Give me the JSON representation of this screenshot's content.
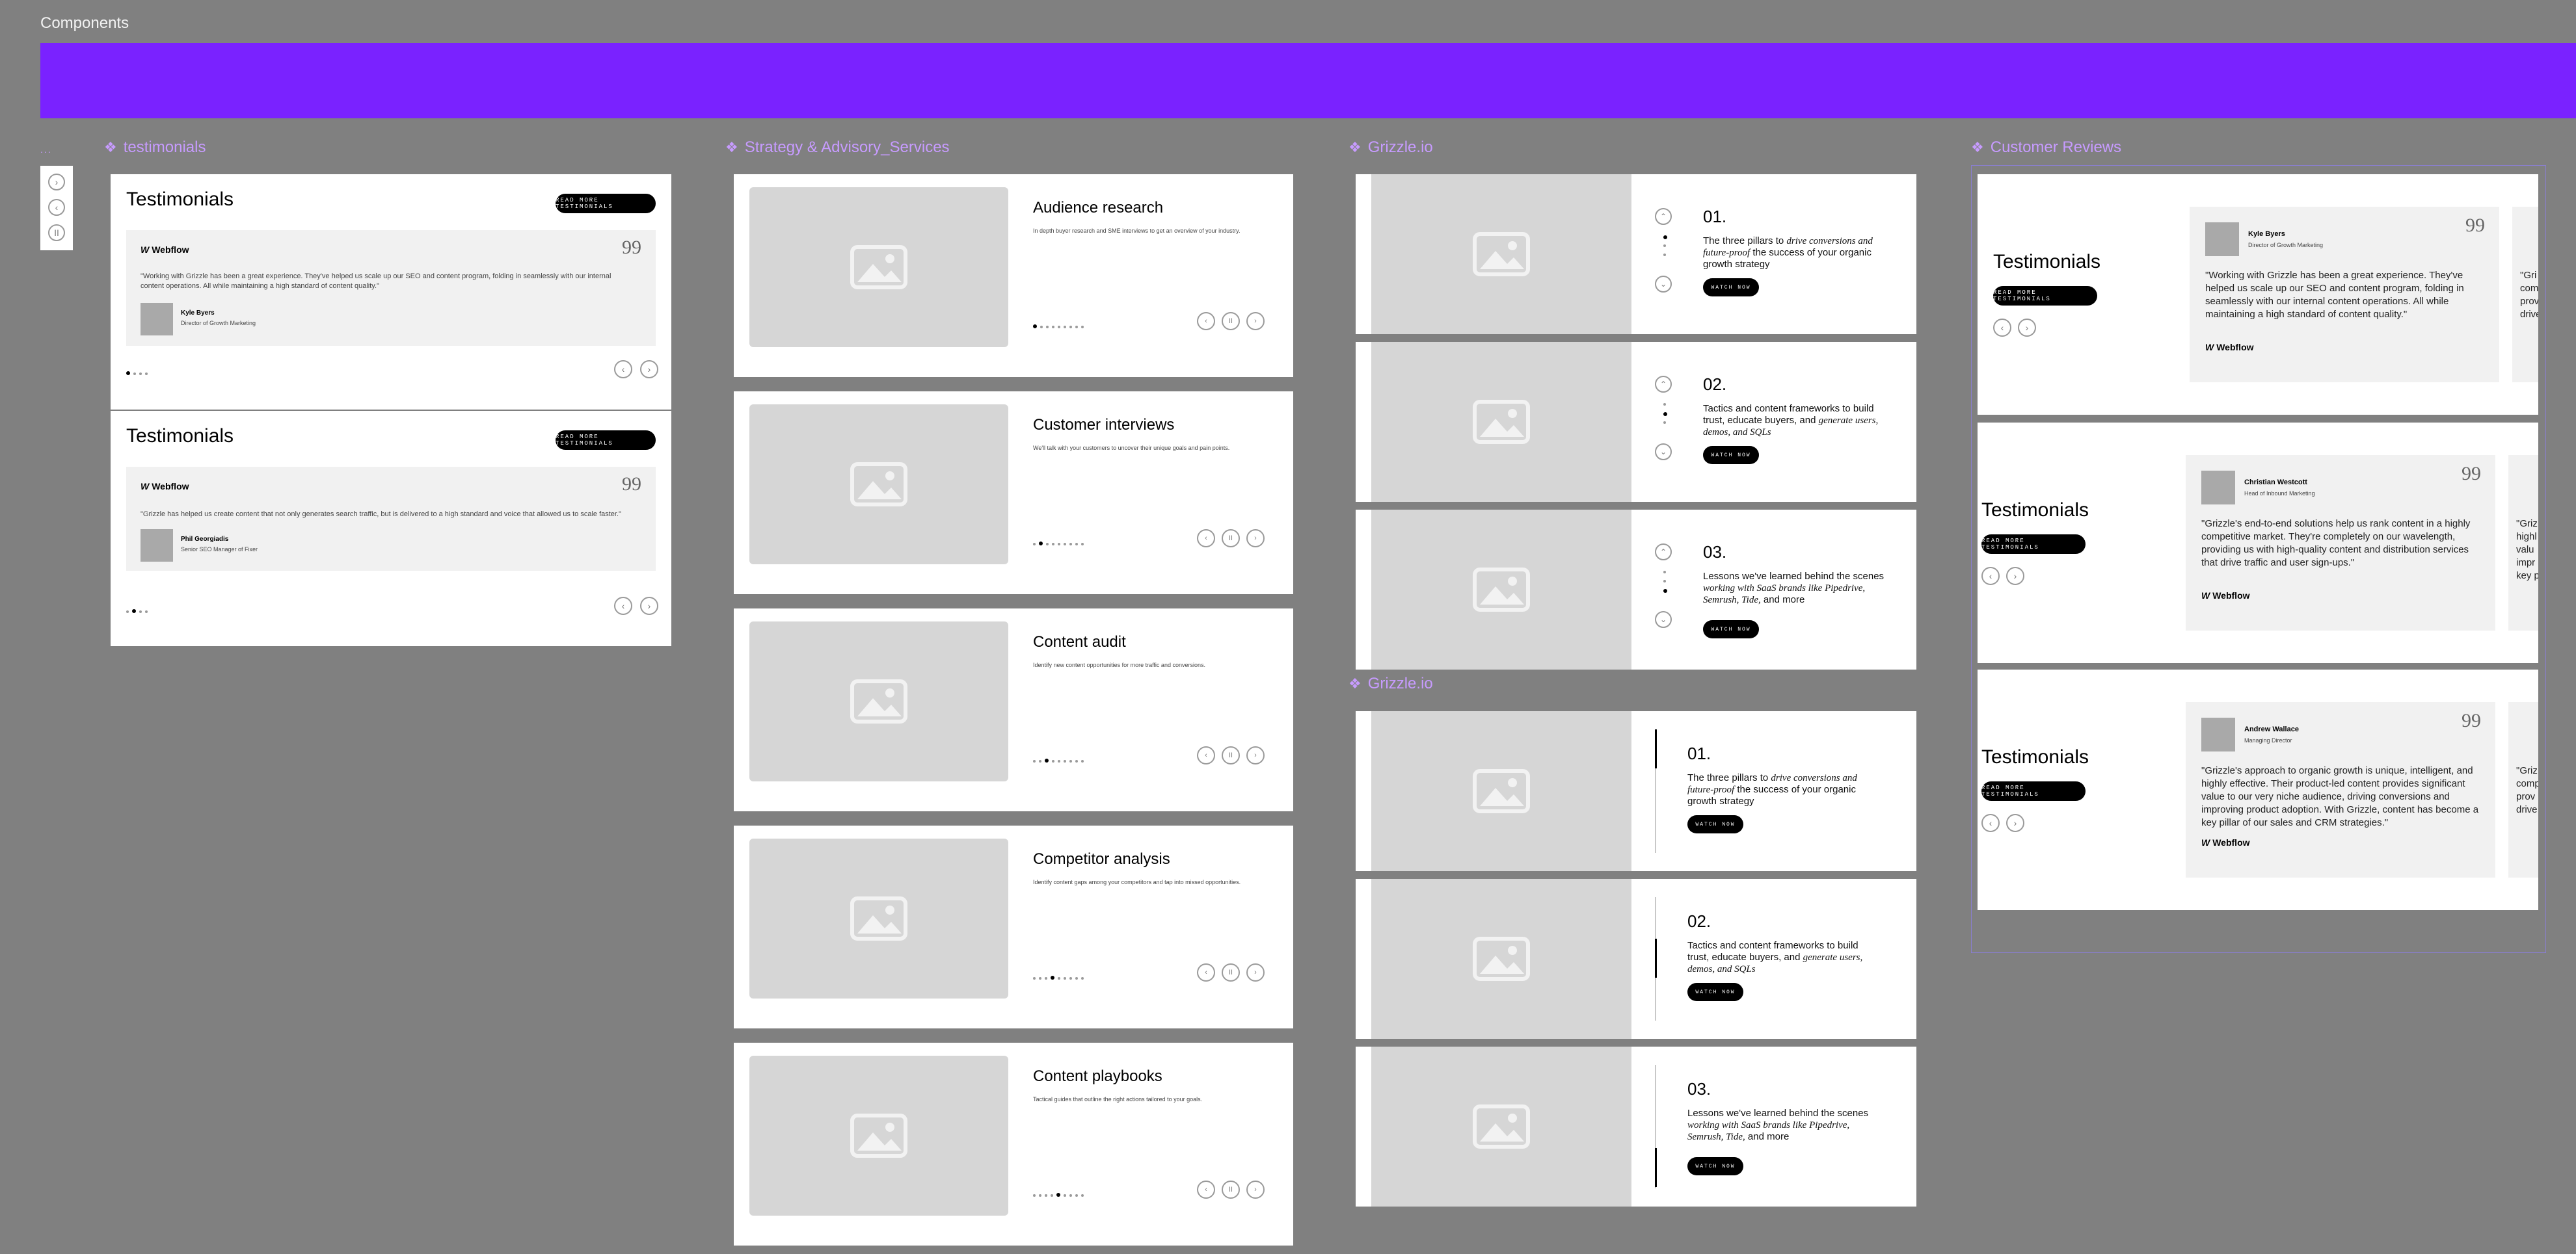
{
  "page_title": "Components",
  "colors": {
    "canvas": "#808080",
    "banner": "#7a22ff",
    "frame_label": "#c79bff"
  },
  "icons": {
    "component": "component-diamond-icon",
    "image": "image-placeholder-icon",
    "quote": "quote-icon"
  },
  "tiny_frame_label": "...",
  "frames": {
    "testimonials": {
      "label": "testimonials"
    },
    "strategy": {
      "label": "Strategy & Advisory_Services"
    },
    "grizzle1": {
      "label": "Grizzle.io"
    },
    "grizzle2": {
      "label": "Grizzle.io"
    },
    "reviews": {
      "label": "Customer Reviews"
    }
  },
  "testimonials": [
    {
      "title": "Testimonials",
      "button": "READ MORE TESTIMONIALS",
      "brand": "Webflow",
      "quote_mark": "99",
      "text": "\"Working with Grizzle has been a great experience. They've helped us scale up our SEO and content program, folding in seamlessly with our internal content operations. All while maintaining a high standard of content quality.\"",
      "name": "Kyle Byers",
      "role": "Director of Growth Marketing"
    },
    {
      "title": "Testimonials",
      "button": "READ MORE TESTIMONIALS",
      "brand": "Webflow",
      "quote_mark": "99",
      "text": "\"Grizzle has helped us create content that not only generates search traffic, but is delivered to a high standard and voice that allowed us to scale faster.\"",
      "name": "Phil Georgiadis",
      "role": "Senior SEO Manager of Fixer"
    }
  ],
  "services": [
    {
      "title": "Audience research",
      "desc": "In depth buyer research and SME interviews to get an overview of your industry."
    },
    {
      "title": "Customer interviews",
      "desc": "We'll talk with your customers to uncover their unique goals and pain points."
    },
    {
      "title": "Content audit",
      "desc": "Identify new content opportunities for more traffic and conversions."
    },
    {
      "title": "Competitor analysis",
      "desc": "Identify content gaps among your competitors and tap into missed opportunities."
    },
    {
      "title": "Content playbooks",
      "desc": "Tactical guides that outline the right actions tailored to your goals."
    }
  ],
  "pillars": [
    {
      "num": "01.",
      "pre": "The three pillars to ",
      "em": "drive conversions and future-proof",
      "post": " the success of your organic growth strategy",
      "button": "WATCH NOW"
    },
    {
      "num": "02.",
      "pre": "Tactics and content frameworks to build trust, educate buyers, and ",
      "em": "generate users, demos, and SQLs",
      "post": "",
      "button": "WATCH NOW"
    },
    {
      "num": "03.",
      "pre": "Lessons we've learned behind the scenes ",
      "em": "working with SaaS brands like Pipedrive, Semrush, Tide,",
      "post": " and more",
      "button": "WATCH NOW"
    }
  ],
  "reviews": [
    {
      "title": "Testimonials",
      "button": "READ MORE TESTIMONIALS",
      "name": "Kyle Byers",
      "role": "Director of Growth Marketing",
      "text": "\"Working with Grizzle has been a great experience. They've helped us scale up our SEO and content program, folding in seamlessly with our internal content operations. All while maintaining a high standard of content quality.\"",
      "brand": "Webflow",
      "quote_mark": "99",
      "peek": [
        "\"Gri",
        "com",
        "prov",
        "drive"
      ]
    },
    {
      "title": "Testimonials",
      "button": "READ MORE TESTIMONIALS",
      "name": "Christian Westcott",
      "role": "Head of Inbound Marketing",
      "text": "\"Grizzle's end-to-end solutions help us rank content in a highly competitive market. They're completely on our wavelength, providing us with high-quality content and distribution services that drive traffic and user sign-ups.\"",
      "brand": "Webflow",
      "quote_mark": "99",
      "peek": [
        "\"Griz",
        "highl",
        "valu",
        "impr",
        "key p"
      ]
    },
    {
      "title": "Testimonials",
      "button": "READ MORE TESTIMONIALS",
      "name": "Andrew Wallace",
      "role": "Managing Director",
      "text": "\"Grizzle's approach to organic growth is unique, intelligent, and highly effective. Their product-led content provides significant value to our very niche audience, driving conversions and improving product adoption. With Grizzle, content has become a key pillar of our sales and CRM strategies.\"",
      "brand": "Webflow",
      "quote_mark": "99",
      "peek": [
        "\"Griz",
        "comp",
        "prov",
        "drive"
      ]
    }
  ]
}
